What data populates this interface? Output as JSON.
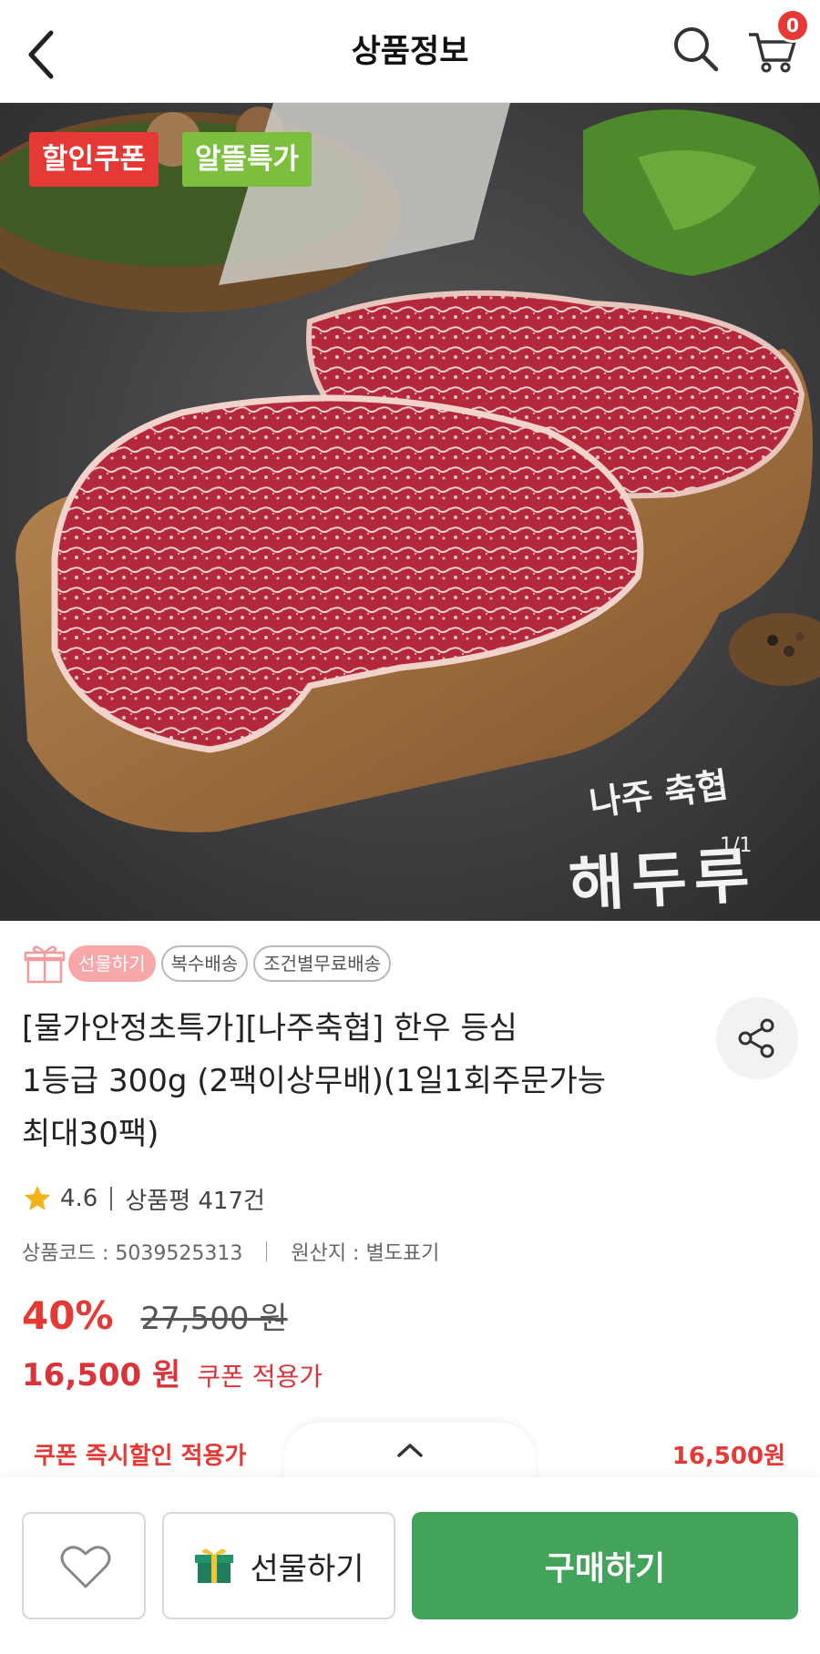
{
  "header": {
    "title": "상품정보",
    "cart_count": "0"
  },
  "hero": {
    "tags": [
      "할인쿠폰",
      "알뜰특가"
    ],
    "brand_line1": "나주 축협",
    "brand_line2": "해두루",
    "image_counter": "1/1"
  },
  "badges": [
    "선물하기",
    "복수배송",
    "조건별무료배송"
  ],
  "product": {
    "name_lines": [
      "[물가안정초특가][나주축협] 한우 등심",
      "1등급 300g (2팩이상무배)(1일1회주문가능",
      "최대30팩)"
    ],
    "rating": "4.6",
    "review_label": "상품평 417건",
    "code": "상품코드 : 5039525313",
    "origin": "원산지 : 별도표기",
    "discount_pct": "40%",
    "original_price": "27,500 원",
    "sale_price": "16,500 원",
    "coupon_label": "쿠폰 적용가"
  },
  "coupon_strip": {
    "label": "쿠폰 즉시할인 적용가",
    "price": "16,500원"
  },
  "bottom_bar": {
    "gift_label": "선물하기",
    "buy_label": "구매하기"
  },
  "colors": {
    "accent_red": "#e53935",
    "tag_green": "#7cbf3f",
    "buy_green": "#43a35a"
  },
  "icons": [
    "back-arrow-icon",
    "search-icon",
    "cart-icon",
    "gift-icon",
    "share-icon",
    "star-icon",
    "chevron-up-icon",
    "heart-icon"
  ]
}
